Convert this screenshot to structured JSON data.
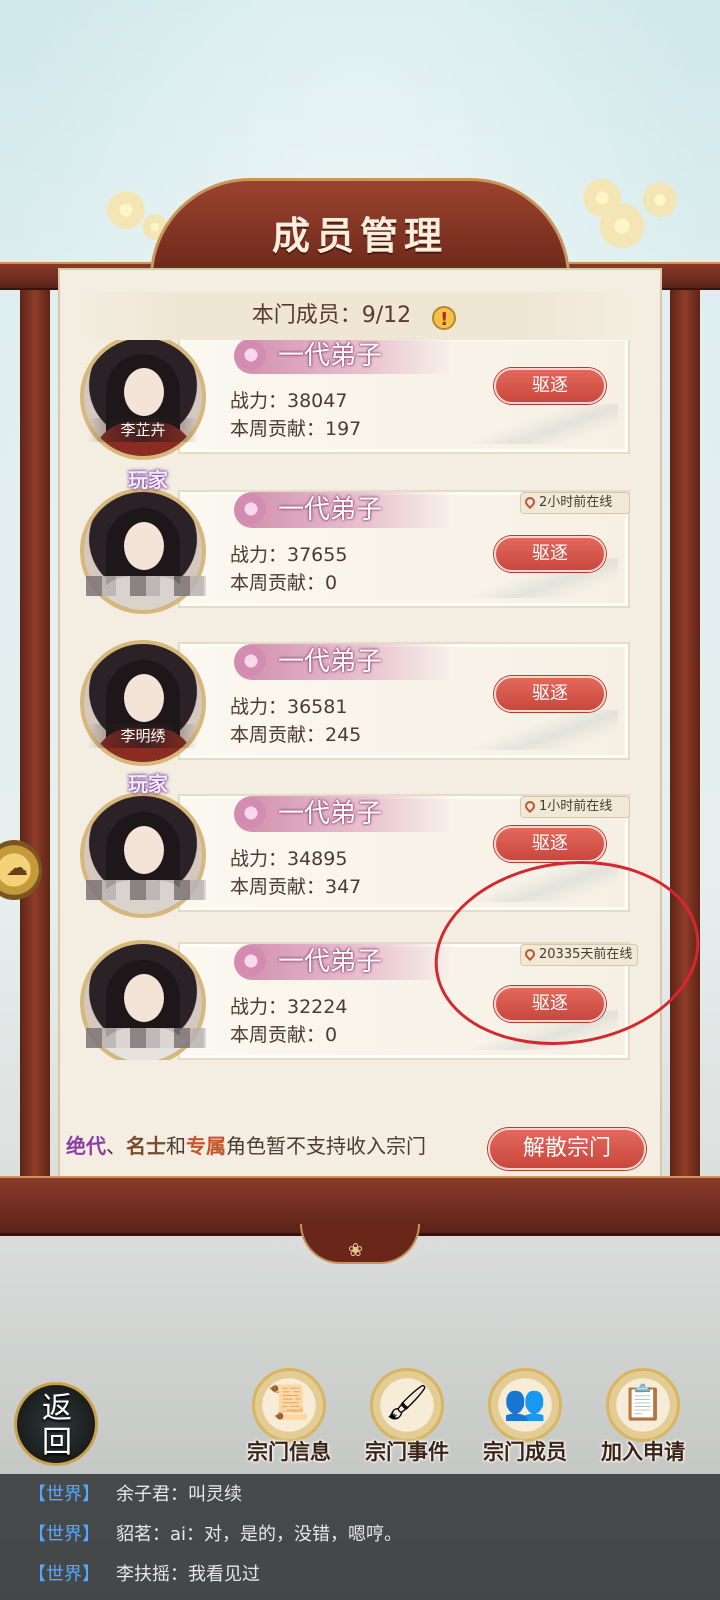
{
  "title": "成员管理",
  "member_count": {
    "label": "本门成员：9/12"
  },
  "members": [
    {
      "rank": "一代弟子",
      "name": "李芷卉",
      "power": "战力：38047",
      "contribution": "本周贡献：197",
      "player": "",
      "online": "",
      "expel_label": "驱逐"
    },
    {
      "rank": "一代弟子",
      "name": "",
      "power": "战力：37655",
      "contribution": "本周贡献：0",
      "player": "玩家",
      "online": "2小时前在线",
      "expel_label": "驱逐"
    },
    {
      "rank": "一代弟子",
      "name": "李明绣",
      "power": "战力：36581",
      "contribution": "本周贡献：245",
      "player": "",
      "online": "",
      "expel_label": "驱逐"
    },
    {
      "rank": "一代弟子",
      "name": "",
      "power": "战力：34895",
      "contribution": "本周贡献：347",
      "player": "玩家",
      "online": "1小时前在线",
      "expel_label": "驱逐"
    },
    {
      "rank": "一代弟子",
      "name": "",
      "power": "战力：32224",
      "contribution": "本周贡献：0",
      "player": "",
      "online": "20335天前在线",
      "expel_label": "驱逐"
    }
  ],
  "footer": {
    "tier1": "绝代",
    "sep1": "、",
    "tier2": "名士",
    "sep2": "和",
    "tier3": "专属",
    "note": "角色暂不支持收入宗门",
    "disband_label": "解散宗门"
  },
  "nav": {
    "back_label": "返回",
    "items": [
      {
        "label": "宗门信息",
        "icon": "scroll-icon"
      },
      {
        "label": "宗门事件",
        "icon": "event-icon"
      },
      {
        "label": "宗门成员",
        "icon": "members-icon"
      },
      {
        "label": "加入申请",
        "icon": "application-icon"
      }
    ]
  },
  "chat": [
    {
      "channel": "【世界】",
      "text": "余子君：叫灵续"
    },
    {
      "channel": "【世界】",
      "text": "貂茗：ai：对，是的，没错，嗯哼。"
    },
    {
      "channel": "【世界】",
      "text": "李扶摇：我看见过"
    }
  ],
  "colors": {
    "frame": "#7a3020",
    "accent_red": "#d5574b",
    "panel": "#f4eee2",
    "chat_tag": "#55a8ff"
  }
}
